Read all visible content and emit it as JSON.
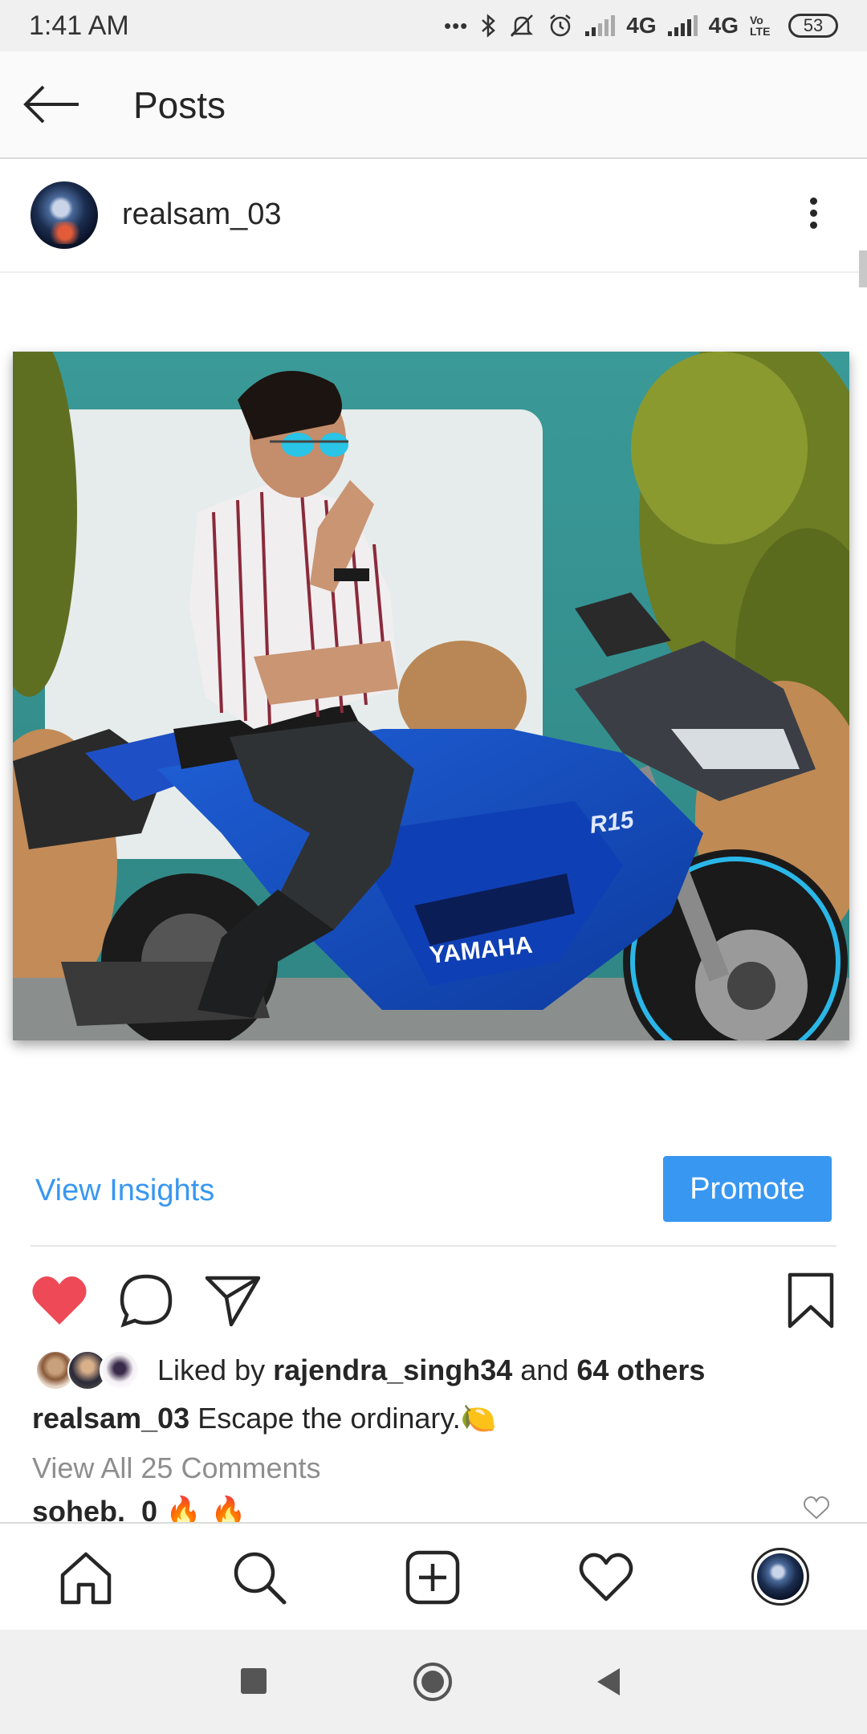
{
  "status_bar": {
    "time": "1:41 AM",
    "dots": "•••",
    "network_1": "4G",
    "network_2": "4G",
    "volte": "Vo LTE",
    "battery": "53",
    "icons": [
      "bluetooth-icon",
      "mute-icon",
      "alarm-icon",
      "signal-icon",
      "signal-icon",
      "battery-icon"
    ]
  },
  "header": {
    "title": "Posts",
    "back_icon": "arrow-left-icon"
  },
  "post": {
    "username": "realsam_03",
    "more_icon": "more-vertical-icon",
    "photo_icon": "photo-image"
  },
  "insights": {
    "view_insights_label": "View Insights",
    "promote_label": "Promote"
  },
  "actions": {
    "like_icon": "heart-filled-icon",
    "comment_icon": "comment-icon",
    "share_icon": "send-icon",
    "save_icon": "bookmark-icon",
    "like_color": "#ed4956"
  },
  "likes": {
    "prefix": "Liked by",
    "user": "rajendra_singh34",
    "and": "and",
    "others": "64 others"
  },
  "caption": {
    "username": "realsam_03",
    "text": "Escape the ordinary.",
    "emoji": "🍋"
  },
  "comments": {
    "view_all_label": "View All 25 Comments",
    "first_user": "soheb._0",
    "first_text": "🔥 🔥"
  },
  "bottom_nav": {
    "items": [
      "home-icon",
      "search-icon",
      "add-post-icon",
      "activity-heart-icon",
      "profile-avatar"
    ]
  },
  "colors": {
    "accent": "#3897f0",
    "text": "#262626",
    "muted": "#8e8e8e"
  }
}
